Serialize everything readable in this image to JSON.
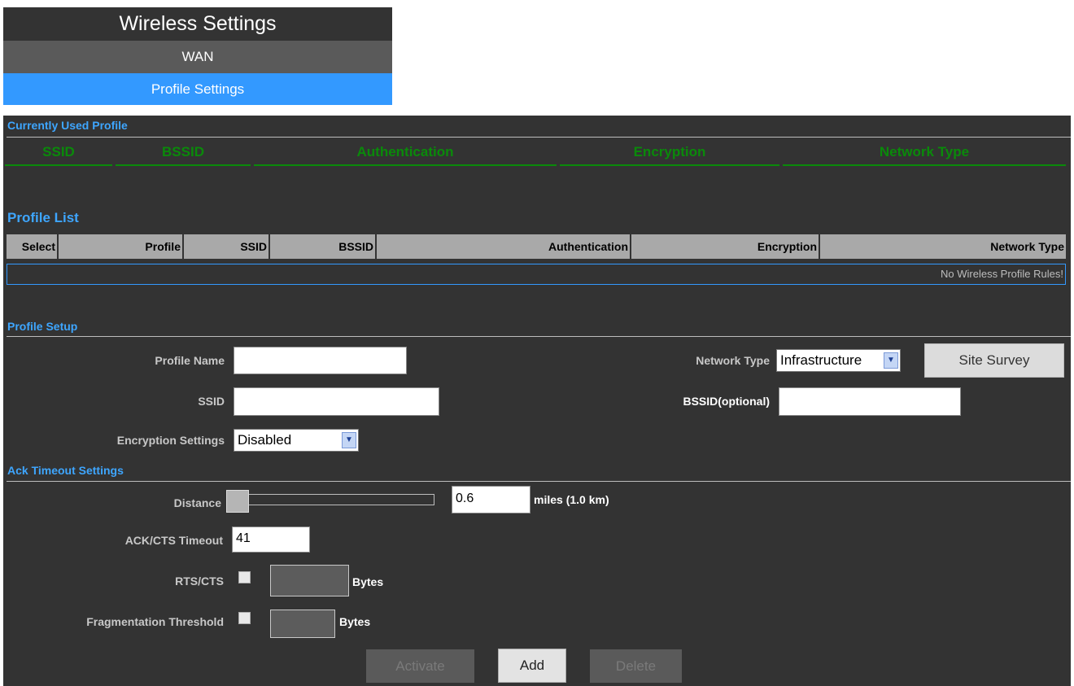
{
  "menu": {
    "title": "Wireless Settings",
    "wan": "WAN",
    "profile_settings": "Profile Settings"
  },
  "current_profile": {
    "title": "Currently Used Profile",
    "columns": [
      "SSID",
      "BSSID",
      "Authentication",
      "Encryption",
      "Network Type"
    ]
  },
  "profile_list": {
    "title": "Profile List",
    "columns": [
      "Select",
      "Profile",
      "SSID",
      "BSSID",
      "Authentication",
      "Encryption",
      "Network Type"
    ],
    "empty_message": "No Wireless Profile Rules!"
  },
  "profile_setup": {
    "title": "Profile Setup",
    "profile_name_label": "Profile Name",
    "profile_name_value": "",
    "ssid_label": "SSID",
    "ssid_value": "",
    "encryption_label": "Encryption Settings",
    "encryption_value": "Disabled",
    "network_type_label": "Network Type",
    "network_type_value": "Infrastructure",
    "site_survey_label": "Site Survey",
    "bssid_label": "BSSID(optional)",
    "bssid_value": ""
  },
  "ack_timeout": {
    "title": "Ack Timeout Settings",
    "distance_label": "Distance",
    "distance_value": "0.6",
    "distance_slider_fraction": 0.0,
    "distance_unit": "miles (1.0 km)",
    "ack_cts_label": "ACK/CTS Timeout",
    "ack_cts_value": "41",
    "rts_cts_label": "RTS/CTS",
    "rts_cts_checked": false,
    "frag_label": "Fragmentation Threshold",
    "frag_checked": false,
    "bytes_label": "Bytes"
  },
  "actions": {
    "activate": "Activate",
    "add": "Add",
    "delete": "Delete"
  },
  "colors": {
    "accent_blue": "#3399ff",
    "section_title": "#3ea6ff",
    "header_green": "#0a8a0a",
    "panel_bg": "#333333"
  }
}
